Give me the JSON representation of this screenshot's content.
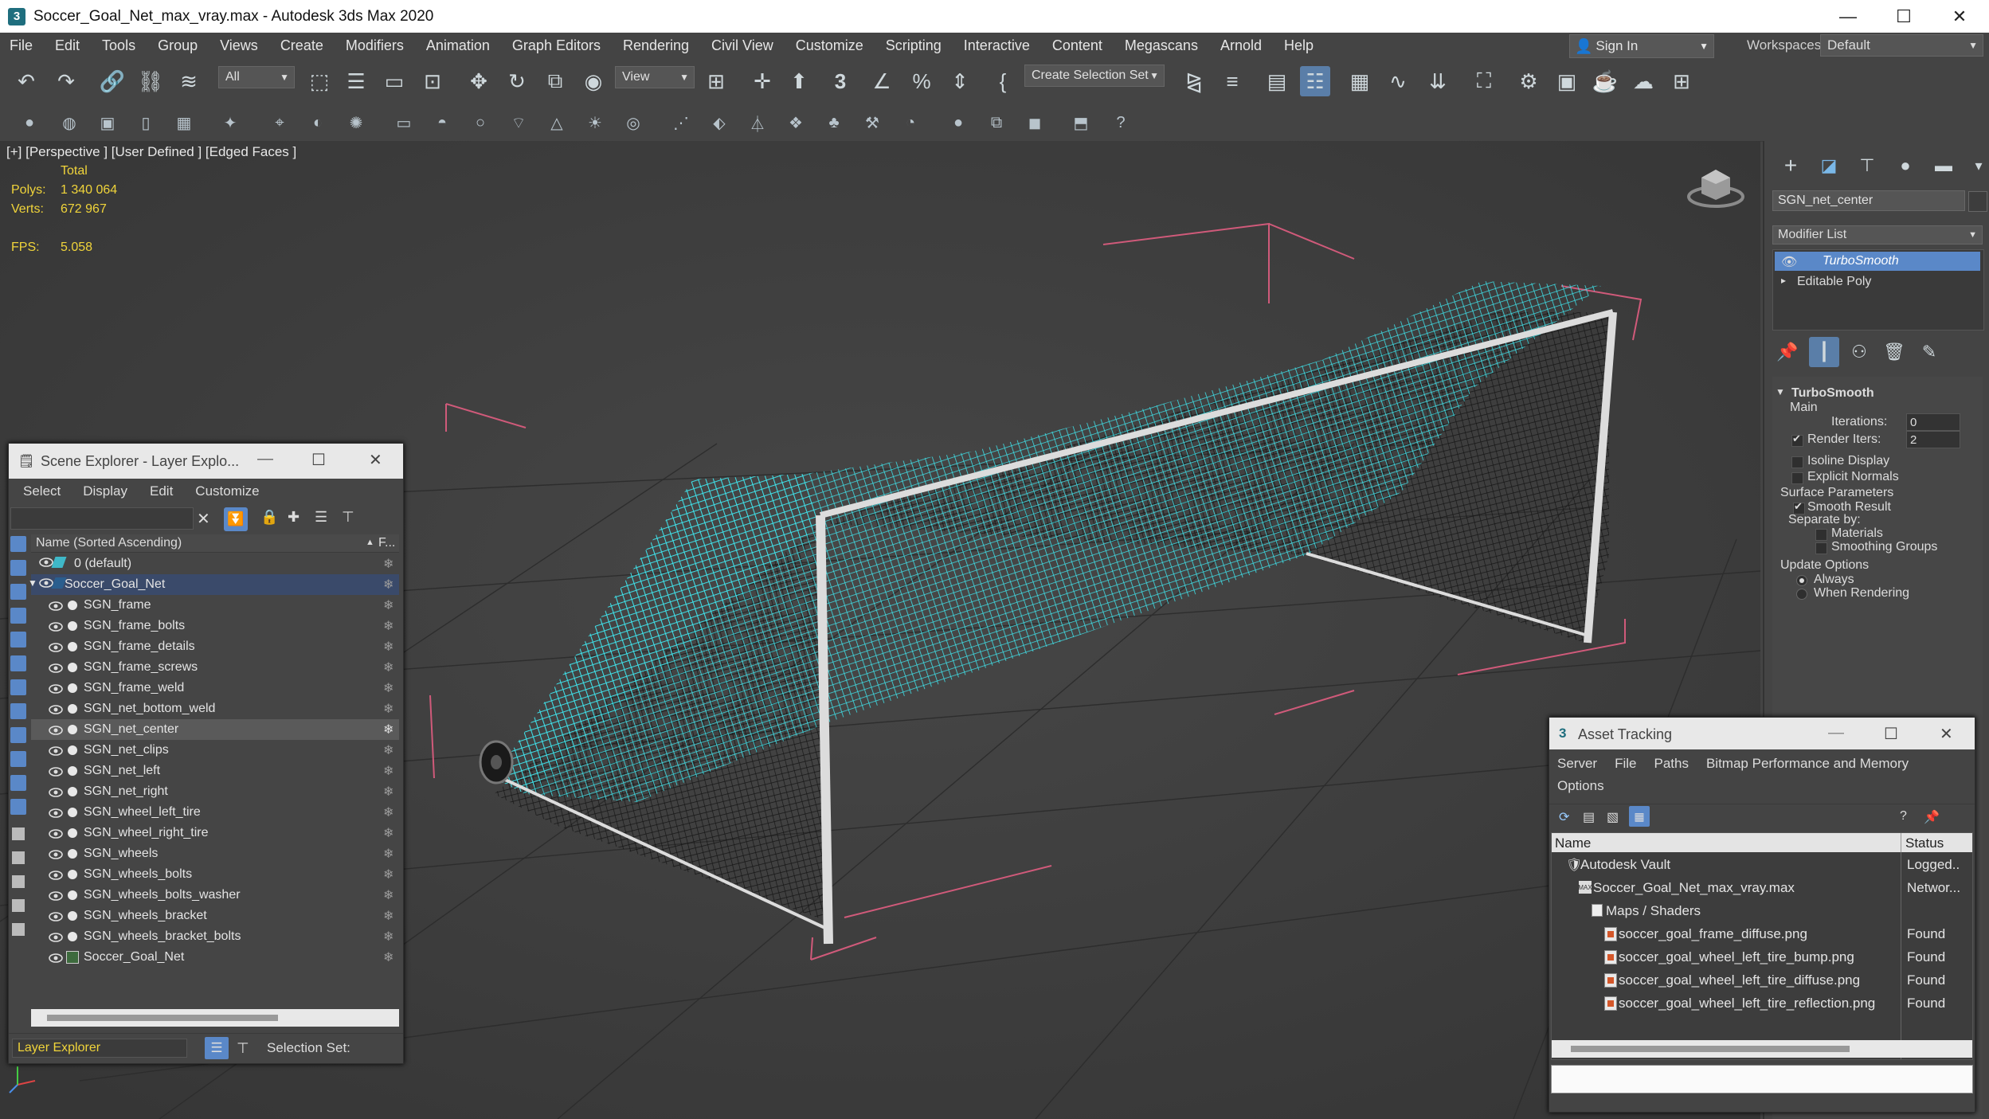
{
  "window": {
    "title": "Soccer_Goal_Net_max_vray.max - Autodesk 3ds Max 2020",
    "app_icon": "3",
    "minimize": "—",
    "maximize": "☐",
    "close": "✕"
  },
  "menubar": {
    "items": [
      "File",
      "Edit",
      "Tools",
      "Group",
      "Views",
      "Create",
      "Modifiers",
      "Animation",
      "Graph Editors",
      "Rendering",
      "Civil View",
      "Customize",
      "Scripting",
      "Interactive",
      "Content",
      "Megascans",
      "Arnold",
      "Help"
    ],
    "sign_in": "Sign In",
    "workspaces_label": "Workspaces:",
    "workspaces_value": "Default"
  },
  "toolbar": {
    "selection_filter": "All",
    "ref_coord": "View",
    "selection_set": "Create Selection Set",
    "three_label": "3"
  },
  "viewport": {
    "label": "[+] [Perspective ] [User Defined ] [Edged Faces ]",
    "total_label": "Total",
    "polys_label": "Polys:",
    "polys_value": "1 340 064",
    "verts_label": "Verts:",
    "verts_value": "672 967",
    "fps_label": "FPS:",
    "fps_value": "5.058"
  },
  "command_panel": {
    "object_name": "SGN_net_center",
    "modifier_list_label": "Modifier List",
    "stack": [
      "TurboSmooth",
      "Editable Poly"
    ],
    "rollout_title": "TurboSmooth",
    "main_label": "Main",
    "iterations_label": "Iterations:",
    "iterations_value": "0",
    "render_iters_label": "Render Iters:",
    "render_iters_value": "2",
    "isoline_label": "Isoline Display",
    "explicit_normals_label": "Explicit Normals",
    "surface_params_label": "Surface Parameters",
    "smooth_result_label": "Smooth Result",
    "separate_by_label": "Separate by:",
    "materials_label": "Materials",
    "smoothing_groups_label": "Smoothing Groups",
    "update_options_label": "Update Options",
    "always_label": "Always",
    "when_rendering_label": "When Rendering"
  },
  "scene_explorer": {
    "title": "Scene Explorer - Layer Explo...",
    "menu": [
      "Select",
      "Display",
      "Edit",
      "Customize"
    ],
    "column_name": "Name (Sorted Ascending)",
    "column_freeze": "F...",
    "sort_indicator": "▲",
    "rows": [
      {
        "name": "0 (default)",
        "level": 0,
        "kind": "layer"
      },
      {
        "name": "Soccer_Goal_Net",
        "level": 0,
        "kind": "layer-open"
      },
      {
        "name": "SGN_frame",
        "level": 1,
        "kind": "obj"
      },
      {
        "name": "SGN_frame_bolts",
        "level": 1,
        "kind": "obj"
      },
      {
        "name": "SGN_frame_details",
        "level": 1,
        "kind": "obj"
      },
      {
        "name": "SGN_frame_screws",
        "level": 1,
        "kind": "obj"
      },
      {
        "name": "SGN_frame_weld",
        "level": 1,
        "kind": "obj"
      },
      {
        "name": "SGN_net_bottom_weld",
        "level": 1,
        "kind": "obj"
      },
      {
        "name": "SGN_net_center",
        "level": 1,
        "kind": "obj-selected"
      },
      {
        "name": "SGN_net_clips",
        "level": 1,
        "kind": "obj"
      },
      {
        "name": "SGN_net_left",
        "level": 1,
        "kind": "obj"
      },
      {
        "name": "SGN_net_right",
        "level": 1,
        "kind": "obj"
      },
      {
        "name": "SGN_wheel_left_tire",
        "level": 1,
        "kind": "obj"
      },
      {
        "name": "SGN_wheel_right_tire",
        "level": 1,
        "kind": "obj"
      },
      {
        "name": "SGN_wheels",
        "level": 1,
        "kind": "obj"
      },
      {
        "name": "SGN_wheels_bolts",
        "level": 1,
        "kind": "obj"
      },
      {
        "name": "SGN_wheels_bolts_washer",
        "level": 1,
        "kind": "obj"
      },
      {
        "name": "SGN_wheels_bracket",
        "level": 1,
        "kind": "obj"
      },
      {
        "name": "SGN_wheels_bracket_bolts",
        "level": 1,
        "kind": "obj"
      },
      {
        "name": "Soccer_Goal_Net",
        "level": 1,
        "kind": "group"
      }
    ],
    "footer_explorer": "Layer Explorer",
    "footer_selection_set": "Selection Set:"
  },
  "asset_tracking": {
    "title": "Asset Tracking",
    "menu_row1": [
      "Server",
      "File",
      "Paths",
      "Bitmap Performance and Memory"
    ],
    "menu_row2": [
      "Options"
    ],
    "col_name": "Name",
    "col_status": "Status",
    "rows": [
      {
        "name": "Autodesk Vault",
        "status": "Logged..",
        "level": 0,
        "icon": "vault"
      },
      {
        "name": "Soccer_Goal_Net_max_vray.max",
        "status": "Networ...",
        "level": 1,
        "icon": "max"
      },
      {
        "name": "Maps / Shaders",
        "status": "",
        "level": 2,
        "icon": "folder"
      },
      {
        "name": "soccer_goal_frame_diffuse.png",
        "status": "Found",
        "level": 3,
        "icon": "file"
      },
      {
        "name": "soccer_goal_wheel_left_tire_bump.png",
        "status": "Found",
        "level": 3,
        "icon": "file"
      },
      {
        "name": "soccer_goal_wheel_left_tire_diffuse.png",
        "status": "Found",
        "level": 3,
        "icon": "file"
      },
      {
        "name": "soccer_goal_wheel_left_tire_reflection.png",
        "status": "Found",
        "level": 3,
        "icon": "file"
      }
    ]
  },
  "colors": {
    "selection_cyan": "#3fe8f0",
    "stat_yellow": "#f0d43a",
    "highlight_blue": "#5a7ea8",
    "bounding_pink": "#d05a7a"
  }
}
